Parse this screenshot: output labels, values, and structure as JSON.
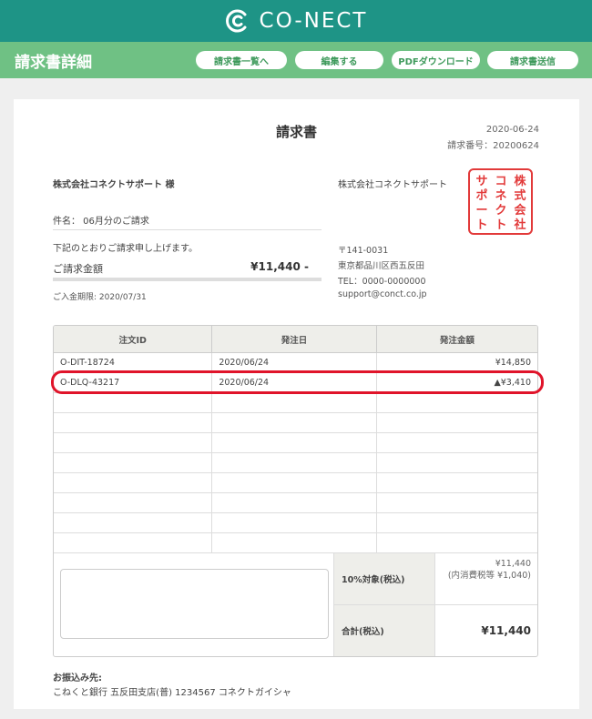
{
  "brand": {
    "name": "CO-NECT",
    "logo_icon": "conect-logo-icon"
  },
  "header": {
    "title": "請求書詳細",
    "buttons": [
      "請求書一覧へ",
      "編集する",
      "PDFダウンロード",
      "請求書送信"
    ]
  },
  "invoice": {
    "title": "請求書",
    "date": "2020-06-24",
    "number": "請求番号：20200624",
    "customer": "株式会社コネクトサポート 様",
    "subject": "件名： 06月分のご請求",
    "lead": "下記のとおりご請求申し上げます。",
    "amount_label": "ご請求金額",
    "amount_value": "¥11,440 -",
    "due": "ご入金期限: 2020/07/31",
    "issuer": {
      "company": "株式会社コネクトサポート",
      "postal": "〒141-0031",
      "address": "東京都品川区西五反田",
      "tel": "TEL：0000-0000000",
      "email": "support@conct.co.jp"
    },
    "seal": {
      "lines": [
        "株式会社",
        "コネクト",
        "サポート"
      ],
      "color": "#e23a3a"
    },
    "table": {
      "headers": [
        "注文ID",
        "発注日",
        "発注金額"
      ],
      "rows": [
        [
          "O-DIT-18724",
          "2020/06/24",
          "¥14,850"
        ],
        [
          "O-DLQ-43217",
          "2020/06/24",
          "▲¥3,410"
        ],
        [
          "",
          "",
          ""
        ],
        [
          "",
          "",
          ""
        ],
        [
          "",
          "",
          ""
        ],
        [
          "",
          "",
          ""
        ],
        [
          "",
          "",
          ""
        ],
        [
          "",
          "",
          ""
        ],
        [
          "",
          "",
          ""
        ],
        [
          "",
          "",
          ""
        ]
      ]
    },
    "tax_label": "10%対象(税込)",
    "tax_value": "¥11,440\n(内消費税等 ¥1,040)",
    "total_label": "合計(税込)",
    "total_value": "¥11,440",
    "bank_title": "お振込み先:",
    "bank_detail": "こねくと銀行 五反田支店(普) 1234567 コネクトガイシャ"
  },
  "colors": {
    "brand": "#1e9486",
    "subbar": "#6fc184",
    "highlight": "#e0142a"
  }
}
